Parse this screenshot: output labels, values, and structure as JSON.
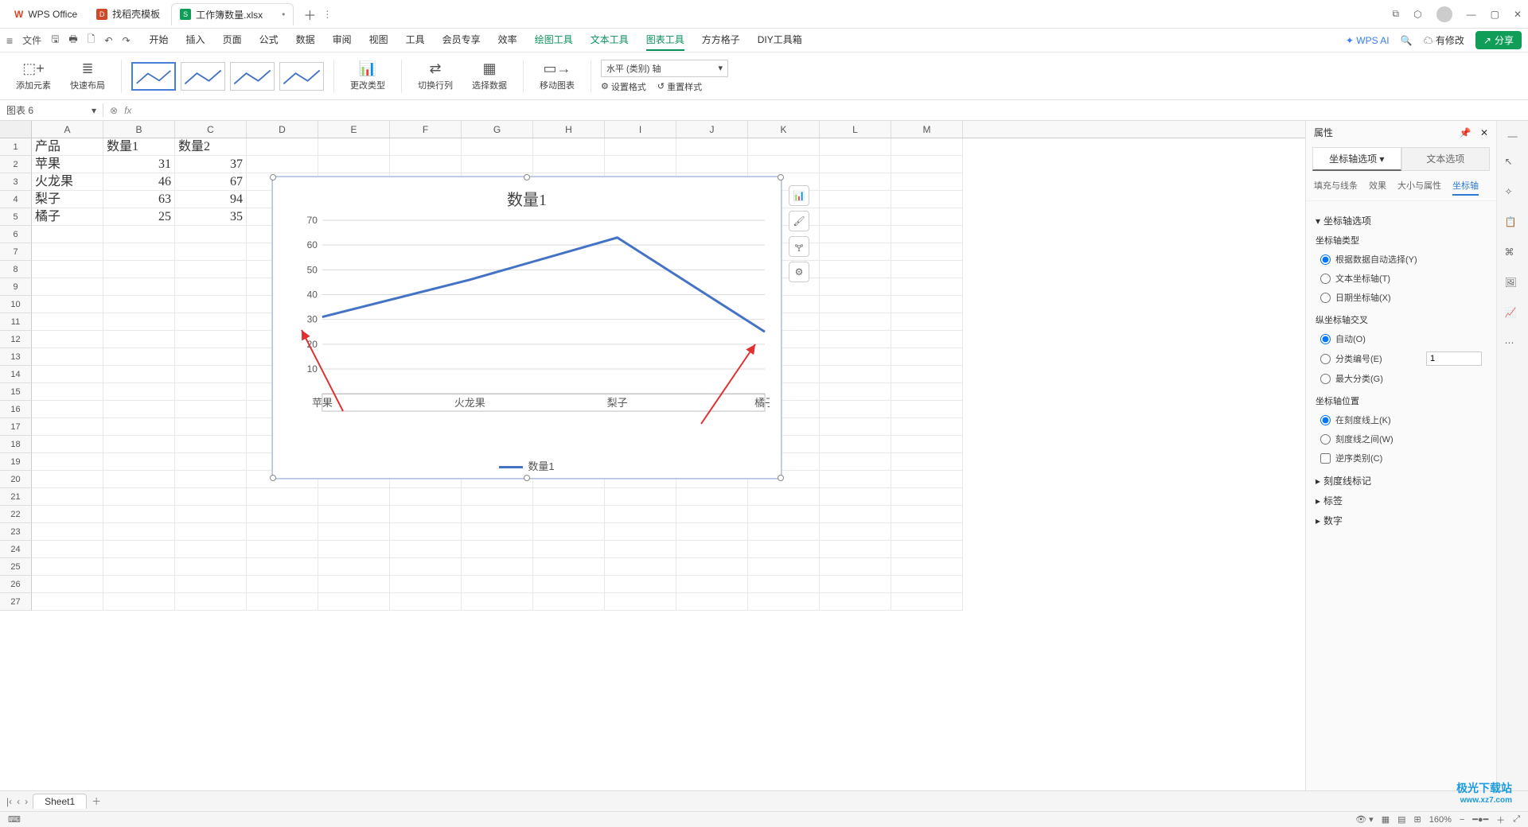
{
  "titlebar": {
    "app": "WPS Office",
    "tab_template": "找稻壳模板",
    "tab_file": "工作簿数量.xlsx"
  },
  "menu": {
    "file": "文件",
    "tabs": [
      "开始",
      "插入",
      "页面",
      "公式",
      "数据",
      "审阅",
      "视图",
      "工具",
      "会员专享",
      "效率",
      "绘图工具",
      "文本工具",
      "图表工具",
      "方方格子",
      "DIY工具箱"
    ],
    "active": "图表工具",
    "ai": "WPS AI",
    "mod": "有修改",
    "share": "分享"
  },
  "ribbon": {
    "addElement": "添加元素",
    "quickLayout": "快速布局",
    "changeType": "更改类型",
    "switchRowCol": "切换行列",
    "selectData": "选择数据",
    "moveChart": "移动图表",
    "axisSelect": "水平 (类别) 轴",
    "setFormat": "设置格式",
    "resetStyle": "重置样式"
  },
  "namebox": "图表 6",
  "columns": [
    "A",
    "B",
    "C",
    "D",
    "E",
    "F",
    "G",
    "H",
    "I",
    "J",
    "K",
    "L",
    "M"
  ],
  "data": {
    "headers": [
      "产品",
      "数量1",
      "数量2"
    ],
    "rows": [
      [
        "苹果",
        "31",
        "37"
      ],
      [
        "火龙果",
        "46",
        "67"
      ],
      [
        "梨子",
        "63",
        "94"
      ],
      [
        "橘子",
        "25",
        "35"
      ]
    ]
  },
  "chart_data": {
    "type": "line",
    "title": "数量1",
    "categories": [
      "苹果",
      "火龙果",
      "梨子",
      "橘子"
    ],
    "series": [
      {
        "name": "数量1",
        "values": [
          31,
          46,
          63,
          25
        ]
      }
    ],
    "ylabel": "",
    "xlabel": "",
    "ylim": [
      0,
      70
    ],
    "yticks": [
      10,
      20,
      30,
      40,
      50,
      60,
      70
    ],
    "legend": "数量1"
  },
  "sidepanel": {
    "title": "属性",
    "tab1": "坐标轴选项",
    "tab2": "文本选项",
    "subtabs": [
      "填充与线条",
      "效果",
      "大小与属性",
      "坐标轴"
    ],
    "activeSub": "坐标轴",
    "sect_axisOptions": "坐标轴选项",
    "axisType": "坐标轴类型",
    "radio_auto": "根据数据自动选择(Y)",
    "radio_text": "文本坐标轴(T)",
    "radio_date": "日期坐标轴(X)",
    "vertCross": "纵坐标轴交叉",
    "radio_crossAuto": "自动(O)",
    "radio_crossCat": "分类编号(E)",
    "crossCat_val": "1",
    "radio_crossMax": "最大分类(G)",
    "axisPos": "坐标轴位置",
    "radio_onTick": "在刻度线上(K)",
    "radio_between": "刻度线之间(W)",
    "check_reverse": "逆序类别(C)",
    "sect_tickMark": "刻度线标记",
    "sect_label": "标签",
    "sect_number": "数字"
  },
  "sheetTabs": {
    "sheet1": "Sheet1"
  },
  "status": {
    "zoom": "160%"
  },
  "watermark": {
    "name": "极光下载站",
    "url": "www.xz7.com"
  }
}
